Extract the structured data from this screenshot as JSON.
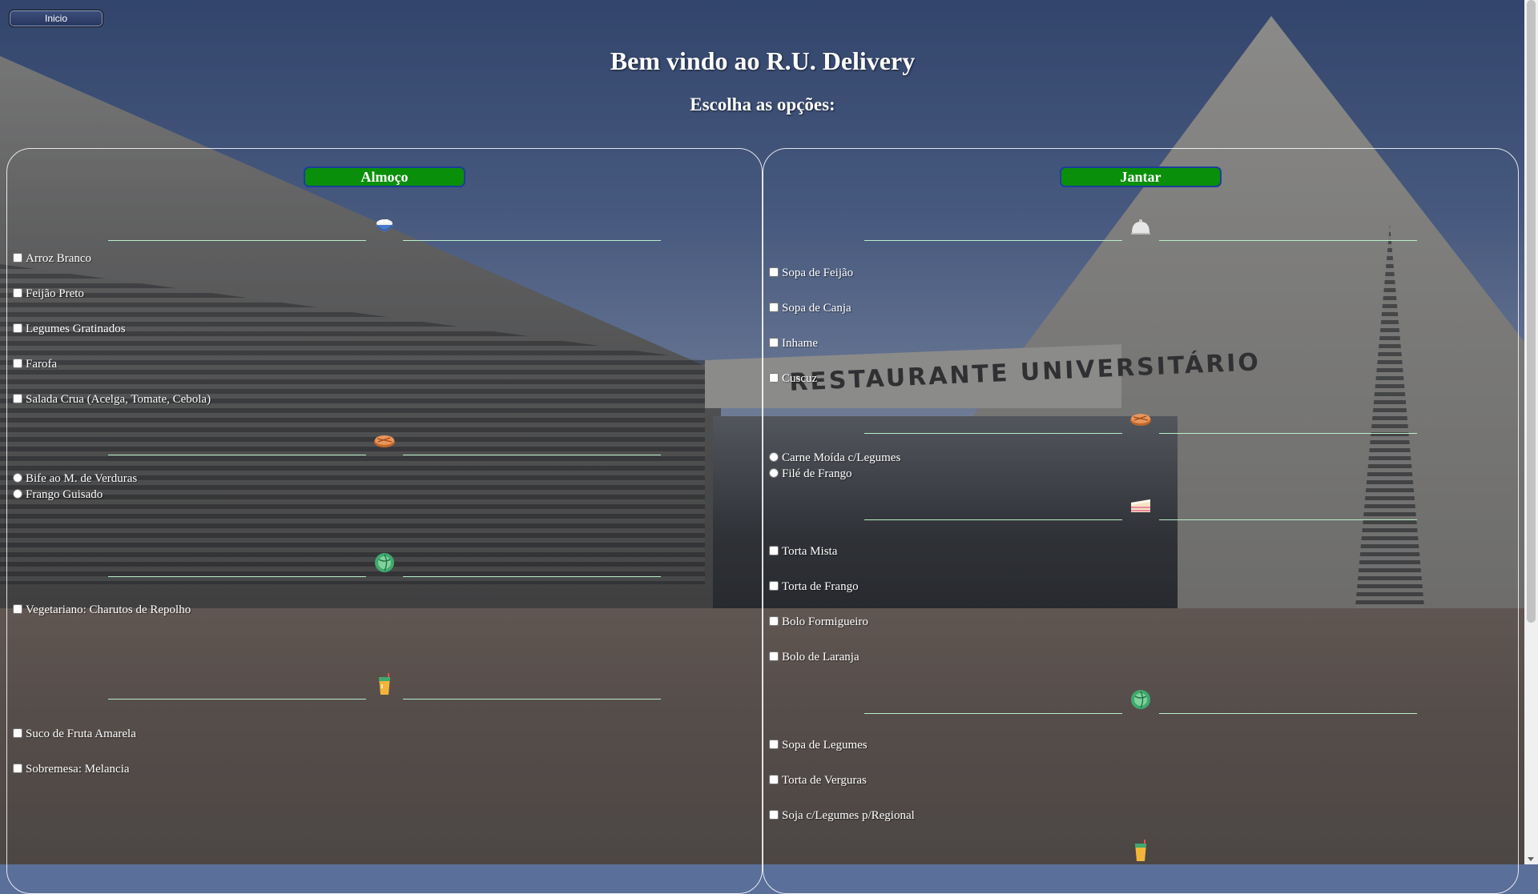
{
  "header": {
    "home_button": "Inicio",
    "title": "Bem vindo ao R.U. Delivery",
    "subtitle": "Escolha as opções:"
  },
  "background": {
    "sign_text": "RESTAURANTE UNIVERSITÁRIO"
  },
  "lunch": {
    "label": "Almoço",
    "sections": [
      {
        "icon": "rice-bowl-icon",
        "type": "checkbox",
        "items": [
          "Arroz Branco",
          "Feijão Preto",
          "Legumes Gratinados",
          "Farofa",
          "Salada Crua (Acelga, Tomate, Cebola)"
        ]
      },
      {
        "icon": "meat-icon",
        "type": "radio",
        "items": [
          "Bife ao M. de Verduras",
          "Frango Guisado"
        ]
      },
      {
        "icon": "cabbage-icon",
        "type": "checkbox",
        "items": [
          "Vegetariano: Charutos de Repolho"
        ]
      },
      {
        "icon": "juice-icon",
        "type": "checkbox",
        "items": [
          "Suco de Fruta Amarela",
          "Sobremesa: Melancia"
        ]
      }
    ]
  },
  "dinner": {
    "label": "Jantar",
    "sections": [
      {
        "icon": "soup-dome-icon",
        "type": "checkbox",
        "items": [
          "Sopa de Feijão",
          "Sopa de Canja",
          "Inhame",
          "Cuscuz"
        ]
      },
      {
        "icon": "meat-icon",
        "type": "radio",
        "items": [
          "Carne Moída c/Legumes",
          "Filé de Frango"
        ]
      },
      {
        "icon": "cake-icon",
        "type": "checkbox",
        "items": [
          "Torta Mista",
          "Torta de Frango",
          "Bolo Formigueiro",
          "Bolo de Laranja"
        ]
      },
      {
        "icon": "cabbage-icon",
        "type": "checkbox",
        "items": [
          "Sopa de Legumes",
          "Torta de Verguras",
          "Soja c/Legumes p/Regional"
        ]
      },
      {
        "icon": "juice-icon",
        "type": "checkbox",
        "items": []
      }
    ]
  },
  "colors": {
    "badge_green": "#0a8f0a",
    "badge_border": "#1b3f9a",
    "divider": "#b8f0c8"
  }
}
